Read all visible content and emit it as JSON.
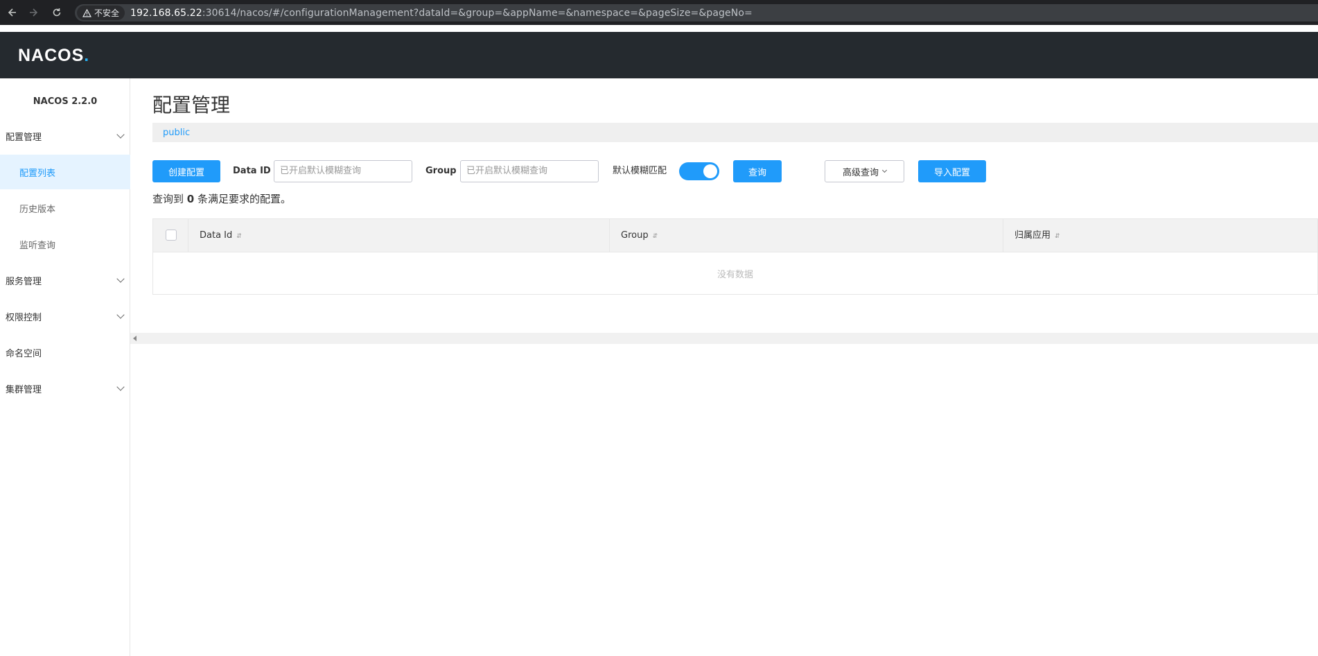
{
  "browser": {
    "insecure_label": "不安全",
    "url_host": "192.168.65.22",
    "url_path": ":30614/nacos/#/configurationManagement?dataId=&group=&appName=&namespace=&pageSize=&pageNo="
  },
  "app": {
    "logo_text_a": "NA",
    "logo_text_b": "C",
    "logo_text_c": "OS",
    "logo_dot": "."
  },
  "sidebar": {
    "version": "NACOS 2.2.0",
    "items": [
      {
        "label": "配置管理",
        "expandable": true
      },
      {
        "label": "配置列表",
        "active": true
      },
      {
        "label": "历史版本"
      },
      {
        "label": "监听查询"
      },
      {
        "label": "服务管理",
        "expandable": true
      },
      {
        "label": "权限控制",
        "expandable": true
      },
      {
        "label": "命名空间"
      },
      {
        "label": "集群管理",
        "expandable": true
      }
    ]
  },
  "main": {
    "title": "配置管理",
    "namespace": "public",
    "toolbar": {
      "create_label": "创建配置",
      "dataid_label": "Data ID",
      "dataid_placeholder": "已开启默认模糊查询",
      "group_label": "Group",
      "group_placeholder": "已开启默认模糊查询",
      "fuzzy_label": "默认模糊匹配",
      "fuzzy_on": true,
      "query_label": "查询",
      "advanced_label": "高级查询",
      "import_label": "导入配置"
    },
    "result_prefix": "查询到",
    "result_count": "0",
    "result_suffix": "条满足要求的配置。",
    "table": {
      "columns": [
        "Data Id",
        "Group",
        "归属应用"
      ],
      "empty_text": "没有数据"
    }
  },
  "colors": {
    "primary": "#209bfa",
    "header_bg": "#252a2f",
    "active_bg": "#e5f3ff"
  }
}
